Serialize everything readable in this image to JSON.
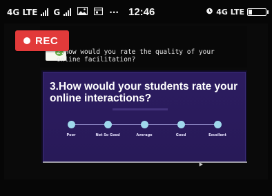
{
  "status_bar": {
    "network_1": "4G LTE",
    "network_2": "G",
    "time": "12:46",
    "right_network": "4G LTE",
    "battery_level": 0.18,
    "icons": [
      "signal-icon",
      "image-icon",
      "calendar-icon",
      "more-icon",
      "alarm-icon",
      "battery-icon"
    ],
    "more_glyph": "···"
  },
  "recording": {
    "label": "REC",
    "color": "#e23a3a"
  },
  "previous_question": {
    "text": "2.How would you rate the quality of your online facilitation?"
  },
  "slide": {
    "title": "3.How would your students rate your online interactions?",
    "background": "#2c1c60",
    "scale": [
      {
        "label": "Poor"
      },
      {
        "label": "Not So Good"
      },
      {
        "label": "Average"
      },
      {
        "label": "Good"
      },
      {
        "label": "Excellent"
      }
    ],
    "point_color": "#9fd8ec"
  }
}
